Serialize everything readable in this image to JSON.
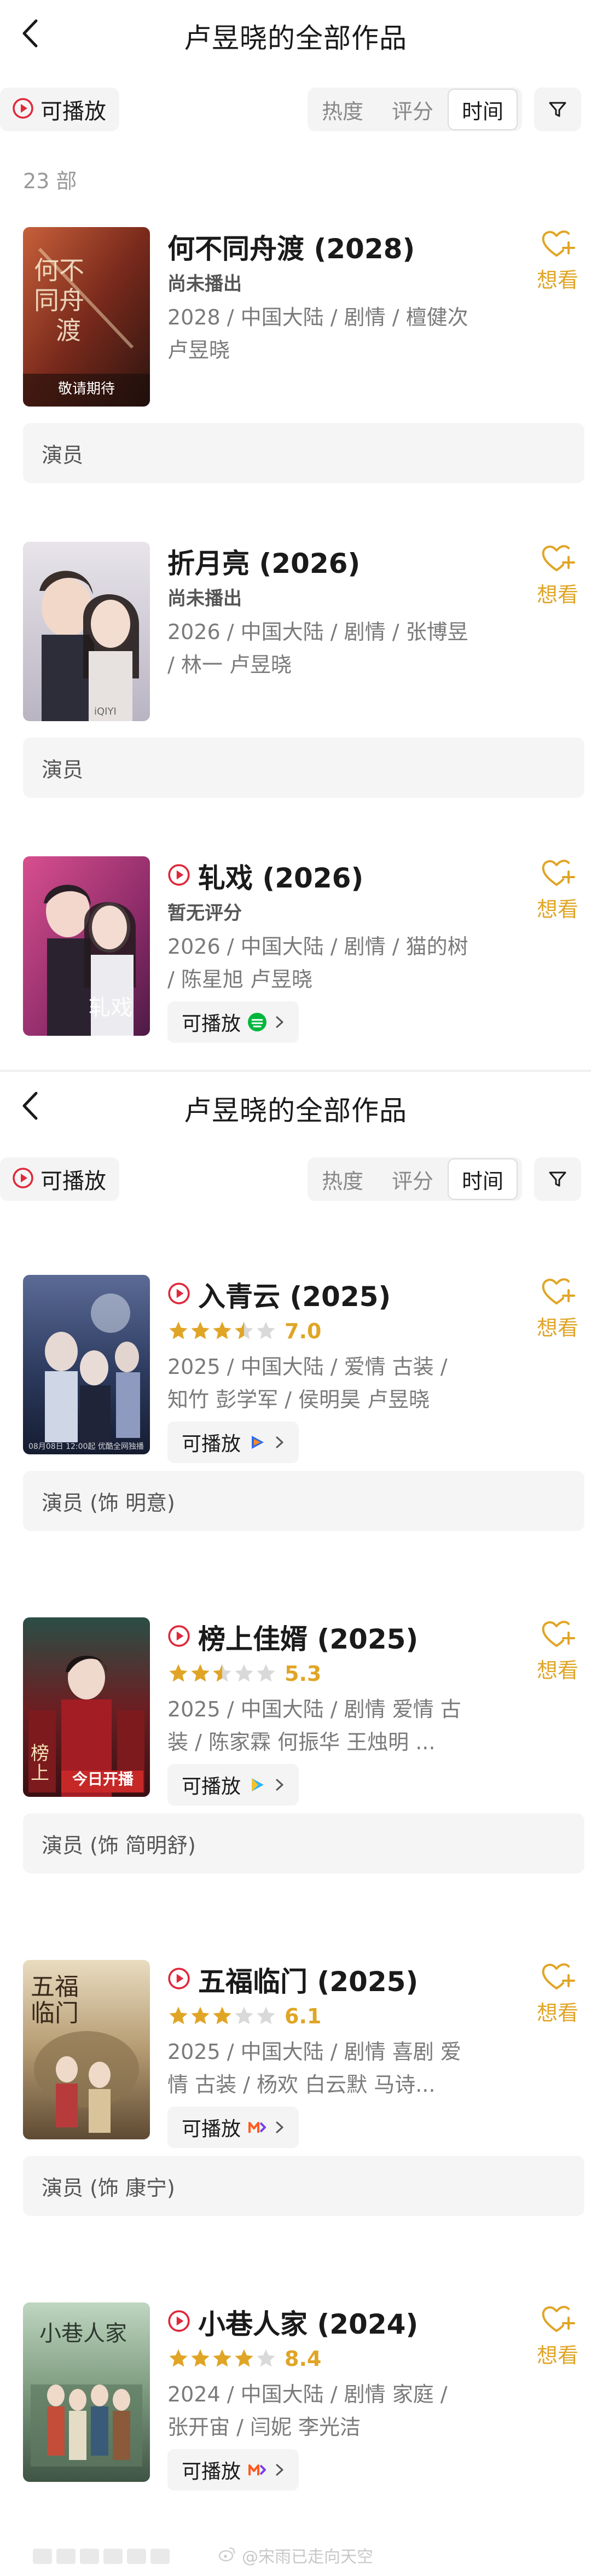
{
  "screen1": {
    "header": {
      "title": "卢昱晓的全部作品"
    },
    "toolbar": {
      "playable_label": "可播放",
      "sort_options": [
        "热度",
        "评分",
        "时间"
      ],
      "active_sort": "时间"
    },
    "count": "23 部",
    "works": [
      {
        "title": "何不同舟渡 (2028)",
        "playable": false,
        "status": "尚未播出",
        "meta": "2028 / 中国大陆 / 剧情 / 檀健次 卢昱晓",
        "poster_caption": "敬请期待",
        "want_label": "想看",
        "role": "演员"
      },
      {
        "title": "折月亮 (2026)",
        "playable": false,
        "status": "尚未播出",
        "meta": "2026 / 中国大陆 / 剧情 / 张博昱 / 林一 卢昱晓",
        "want_label": "想看",
        "role": "演员"
      },
      {
        "title": "轧戏 (2026)",
        "playable": true,
        "status": "暂无评分",
        "meta": "2026 / 中国大陆 / 剧情 / 猫的树 / 陈星旭 卢昱晓",
        "play_label": "可播放",
        "source_icon": "iqiyi-green-icon",
        "want_label": "想看"
      }
    ]
  },
  "screen2": {
    "header": {
      "title": "卢昱晓的全部作品"
    },
    "toolbar": {
      "playable_label": "可播放",
      "sort_options": [
        "热度",
        "评分",
        "时间"
      ],
      "active_sort": "时间"
    },
    "works": [
      {
        "title": "入青云 (2025)",
        "stars": 3.5,
        "score": "7.0",
        "meta": "2025 / 中国大陆 / 爱情 古装 / 知竹 彭学军 / 侯明昊 卢昱晓",
        "play_label": "可播放",
        "source_icon": "tencent-video-icon",
        "want_label": "想看",
        "role": "演员 (饰 明意)"
      },
      {
        "title": "榜上佳婿 (2025)",
        "stars": 2.5,
        "score": "5.3",
        "meta": "2025 / 中国大陆 / 剧情 爱情 古装 / 陈家霖 何振华 王烛明 ...",
        "play_label": "可播放",
        "source_icon": "youku-icon",
        "poster_caption": "今日开播",
        "want_label": "想看",
        "role": "演员 (饰 简明舒)"
      },
      {
        "title": "五福临门 (2025)",
        "stars": 3,
        "score": "6.1",
        "meta": "2025 / 中国大陆 / 剧情 喜剧 爱情 古装 / 杨欢 白云默 马诗...",
        "play_label": "可播放",
        "source_icon": "mgtv-icon",
        "want_label": "想看",
        "role": "演员 (饰 康宁)"
      },
      {
        "title": "小巷人家 (2024)",
        "stars": 4,
        "score": "8.4",
        "meta": "2024 / 中国大陆 / 剧情 家庭 / 张开宙 / 闫妮 李光洁",
        "play_label": "可播放",
        "source_icon": "mgtv-icon",
        "want_label": "想看"
      }
    ],
    "watermark": "@宋雨已走向天空"
  },
  "colors": {
    "accent_red": "#e0283a",
    "accent_gold": "#e0a526",
    "chip_bg": "#f4f4f4"
  }
}
